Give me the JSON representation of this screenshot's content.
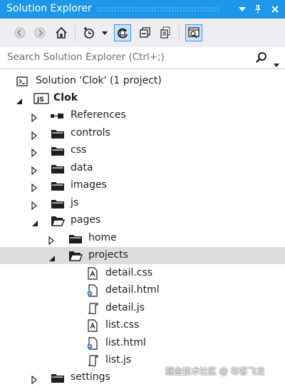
{
  "window": {
    "title": "Solution Explorer",
    "controls": [
      "dropdown-icon",
      "pin-icon",
      "close-icon"
    ]
  },
  "toolbar": {
    "buttons": [
      "back-icon",
      "forward-icon",
      "home-icon",
      "pending-changes-filter-icon",
      "sync-with-active-document-icon",
      "collapse-all-icon",
      "show-all-files-icon",
      "preview-selected-items-icon"
    ]
  },
  "search": {
    "placeholder": "Search Solution Explorer (Ctrl+;)"
  },
  "tree": {
    "solution": "Solution 'Clok' (1 project)",
    "project": "Clok",
    "project_badge": "JS",
    "references": "References",
    "controls": "controls",
    "css": "css",
    "data": "data",
    "images": "images",
    "js": "js",
    "pages": "pages",
    "home": "home",
    "projects": "projects",
    "detail_css": "detail.css",
    "detail_html": "detail.html",
    "detail_js": "detail.js",
    "list_css": "list.css",
    "list_html": "list.html",
    "list_js": "list.js",
    "settings": "settings"
  },
  "watermark": "掘金技术社区 @ 布客飞龙",
  "colors": {
    "titlebar": "#1c97ea",
    "toolbar": "#eeeef2",
    "selected_row": "#dddddd",
    "accent": "#3399ff"
  }
}
